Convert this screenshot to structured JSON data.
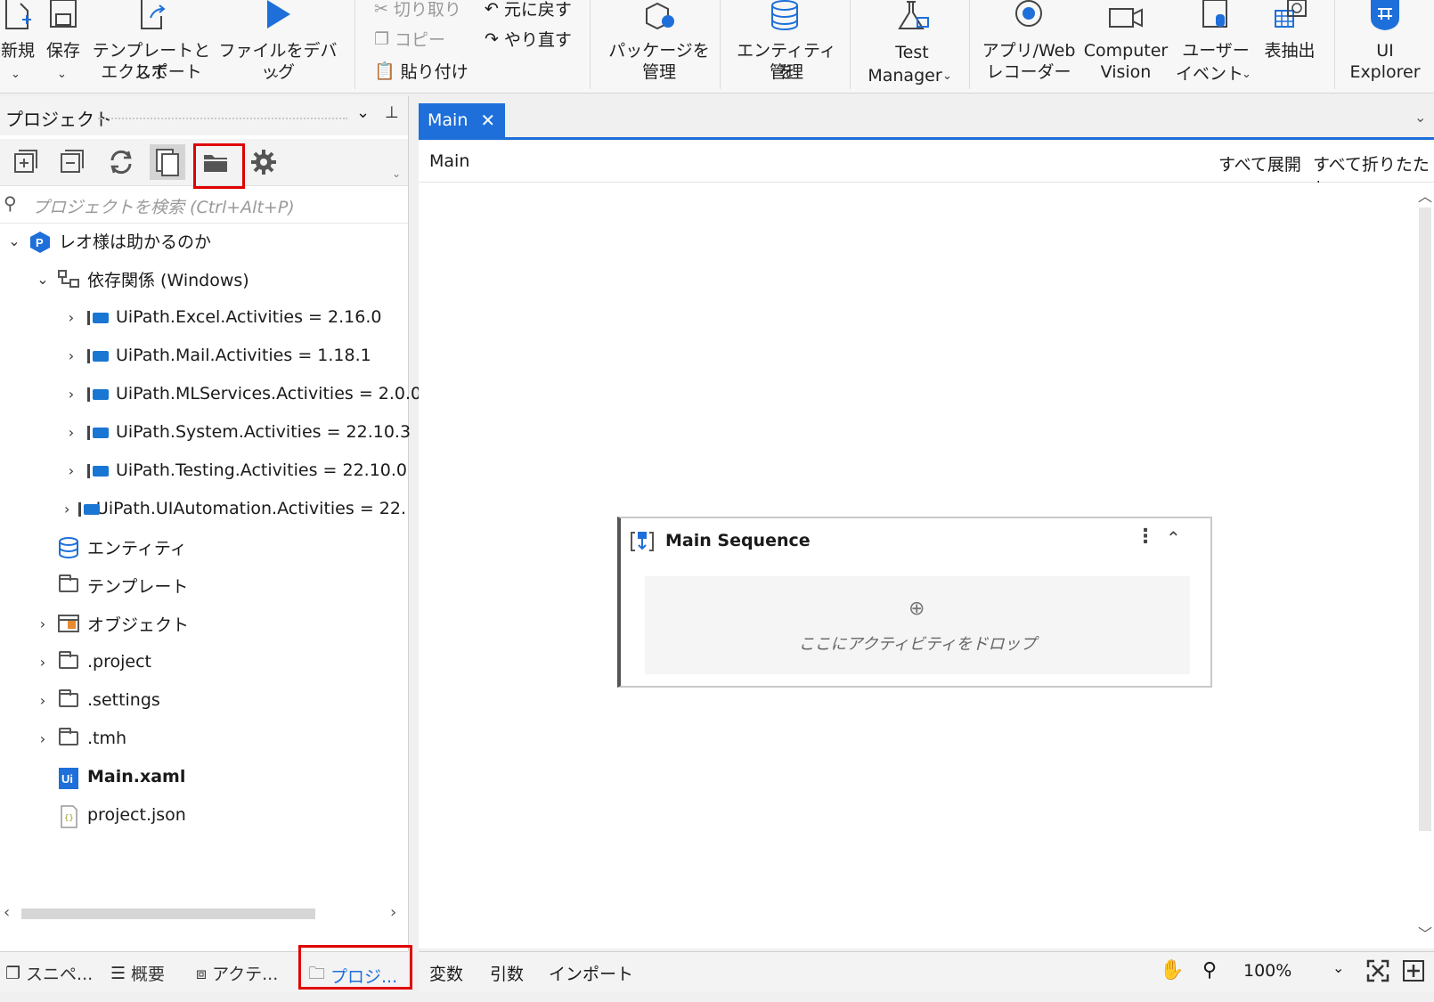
{
  "ribbon": {
    "new_label": "新規",
    "save_label": "保存",
    "export_label_1": "テンプレートとして",
    "export_label_2": "エクスポート",
    "debug_label": "ファイルをデバッグ",
    "cut_label": "切り取り",
    "copy_label": "コピー",
    "paste_label": "貼り付け",
    "undo_label": "元に戻す",
    "redo_label": "やり直す",
    "packages_label_1": "パッケージを",
    "packages_label_2": "管理",
    "entities_label_1": "エンティティを",
    "entities_label_2": "管理",
    "test_manager_1": "Test",
    "test_manager_2": "Manager",
    "recorder_1": "アプリ/Web",
    "recorder_2": "レコーダー",
    "cv_1": "Computer",
    "cv_2": "Vision",
    "user_events_1": "ユーザー",
    "user_events_2": "イベント",
    "table_extract": "表抽出",
    "ui_explorer_1": "UI",
    "ui_explorer_2": "Explorer"
  },
  "project_panel": {
    "title": "プロジェクト",
    "search_placeholder": "プロジェクトを検索 (Ctrl+Alt+P)",
    "root": "レオ様は助かるのか",
    "dependencies": "依存関係 (Windows)",
    "packages": [
      "UiPath.Excel.Activities = 2.16.0",
      "UiPath.Mail.Activities = 1.18.1",
      "UiPath.MLServices.Activities = 2.0.0",
      "UiPath.System.Activities = 22.10.3",
      "UiPath.Testing.Activities = 22.10.0",
      "UiPath.UIAutomation.Activities = 22."
    ],
    "entities": "エンティティ",
    "templates": "テンプレート",
    "objects": "オブジェクト",
    "folders": [
      ".project",
      ".settings",
      ".tmh"
    ],
    "main_file": "Main.xaml",
    "project_file": "project.json"
  },
  "bottom_tabs": {
    "snippets": "スニペ...",
    "outline": "概要",
    "activities": "アクテ...",
    "project": "プロジ..."
  },
  "designer": {
    "tab": "Main",
    "breadcrumb": "Main",
    "expand_all": "すべて展開",
    "collapse_all": "すべて折りたたむ",
    "sequence_title": "Main Sequence",
    "drop_hint": "ここにアクティビティをドロップ",
    "variables": "変数",
    "arguments": "引数",
    "imports": "インポート",
    "zoom": "100%"
  },
  "colors": {
    "accent": "#1e6fd9",
    "highlight": "#e00000",
    "package": "#1976d2"
  }
}
